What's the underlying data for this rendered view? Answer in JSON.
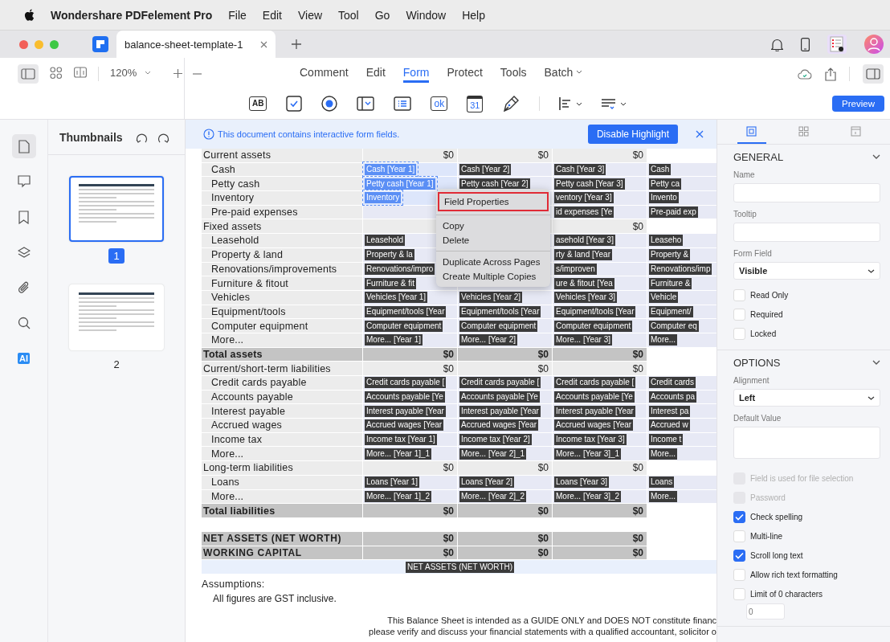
{
  "menubar": {
    "app": "Wondershare PDFelement Pro",
    "items": [
      "File",
      "Edit",
      "View",
      "Tool",
      "Go",
      "Window",
      "Help"
    ]
  },
  "tab": {
    "title": "balance-sheet-template-1"
  },
  "toolbar": {
    "zoom": "120%",
    "modes": [
      {
        "label": "Comment",
        "selected": false,
        "dropdown": false
      },
      {
        "label": "Edit",
        "selected": false,
        "dropdown": false
      },
      {
        "label": "Form",
        "selected": true,
        "dropdown": false
      },
      {
        "label": "Protect",
        "selected": false,
        "dropdown": false
      },
      {
        "label": "Tools",
        "selected": false,
        "dropdown": false
      },
      {
        "label": "Batch",
        "selected": false,
        "dropdown": true
      }
    ],
    "form_tools": [
      {
        "kind": "text-field",
        "glyph": "AB"
      },
      {
        "kind": "checkbox"
      },
      {
        "kind": "radio"
      },
      {
        "kind": "dropdown"
      },
      {
        "kind": "list"
      },
      {
        "kind": "button",
        "glyph": "ok"
      },
      {
        "kind": "date",
        "glyph": "31"
      },
      {
        "kind": "signature"
      }
    ],
    "preview": "Preview"
  },
  "sidebar": {
    "title": "Thumbnails",
    "rail": [
      {
        "kind": "page",
        "selected": true
      },
      {
        "kind": "comment",
        "selected": false
      },
      {
        "kind": "bookmark",
        "selected": false
      },
      {
        "kind": "layers",
        "selected": false
      },
      {
        "kind": "attachment",
        "selected": false
      },
      {
        "kind": "search",
        "selected": false
      },
      {
        "kind": "ai",
        "selected": false,
        "label": "AI"
      }
    ],
    "pages": [
      {
        "number": "1",
        "selected": true
      },
      {
        "number": "2",
        "selected": false
      }
    ]
  },
  "banner": {
    "message": "This document contains interactive form fields.",
    "button": "Disable Highlight"
  },
  "sheet": {
    "rows": [
      {
        "label": "Current assets",
        "kind": "section",
        "cells": [
          {
            "kind": "value",
            "text": "$0"
          },
          {
            "kind": "value",
            "text": "$0"
          },
          {
            "kind": "value",
            "text": "$0"
          },
          {
            "kind": "blank"
          }
        ]
      },
      {
        "label": "Cash",
        "kind": "item",
        "cells": [
          {
            "kind": "tag",
            "text": "Cash [Year 1]",
            "selected": true
          },
          {
            "kind": "tag",
            "text": "Cash [Year 2]",
            "selected": false
          },
          {
            "kind": "tag",
            "text": "Cash [Year 3]",
            "selected": false
          },
          {
            "kind": "tag",
            "text": "Cash",
            "selected": false
          }
        ]
      },
      {
        "label": "Petty cash",
        "kind": "item",
        "cells": [
          {
            "kind": "tag",
            "text": "Petty cash [Year 1]",
            "selected": true
          },
          {
            "kind": "tag",
            "text": "Petty cash [Year 2]",
            "selected": false
          },
          {
            "kind": "tag",
            "text": "Petty cash [Year 3]",
            "selected": false
          },
          {
            "kind": "tag",
            "text": "Petty ca",
            "selected": false
          }
        ]
      },
      {
        "label": "Inventory",
        "kind": "item",
        "cells": [
          {
            "kind": "tag",
            "text": "Inventory",
            "selected": true
          },
          {
            "kind": "blank"
          },
          {
            "kind": "tag",
            "text": "ventory [Year 3]",
            "selected": false
          },
          {
            "kind": "tag",
            "text": "Invento",
            "selected": false
          }
        ]
      },
      {
        "label": "Pre-paid expenses",
        "kind": "item",
        "cells": [
          {
            "kind": "blank"
          },
          {
            "kind": "blank"
          },
          {
            "kind": "tag",
            "text": "id expenses [Ye",
            "selected": false
          },
          {
            "kind": "tag",
            "text": "Pre-paid exp",
            "selected": false
          }
        ]
      },
      {
        "label": "Fixed assets",
        "kind": "section",
        "cells": [
          {
            "kind": "blank"
          },
          {
            "kind": "blank"
          },
          {
            "kind": "value",
            "text": "$0"
          },
          {
            "kind": "blank"
          }
        ]
      },
      {
        "label": "Leasehold",
        "kind": "item",
        "cells": [
          {
            "kind": "tag",
            "text": "Leasehold",
            "selected": false
          },
          {
            "kind": "blank"
          },
          {
            "kind": "tag",
            "text": "asehold [Year 3]",
            "selected": false
          },
          {
            "kind": "tag",
            "text": "Leaseho",
            "selected": false
          }
        ]
      },
      {
        "label": "Property & land",
        "kind": "item",
        "cells": [
          {
            "kind": "tag",
            "text": "Property & la",
            "selected": false
          },
          {
            "kind": "blank"
          },
          {
            "kind": "tag",
            "text": "rty & land [Year",
            "selected": false
          },
          {
            "kind": "tag",
            "text": "Property &",
            "selected": false
          }
        ]
      },
      {
        "label": "Renovations/improvements",
        "kind": "item",
        "cells": [
          {
            "kind": "tag",
            "text": "Renovations/impro",
            "selected": false
          },
          {
            "kind": "blank"
          },
          {
            "kind": "tag",
            "text": "s/improven",
            "selected": false
          },
          {
            "kind": "tag",
            "text": "Renovations/imp",
            "selected": false
          }
        ]
      },
      {
        "label": "Furniture & fitout",
        "kind": "item",
        "cells": [
          {
            "kind": "tag",
            "text": "Furniture & fit",
            "selected": false
          },
          {
            "kind": "blank"
          },
          {
            "kind": "tag",
            "text": "ure & fitout [Yea",
            "selected": false
          },
          {
            "kind": "tag",
            "text": "Furniture &",
            "selected": false
          }
        ]
      },
      {
        "label": "Vehicles",
        "kind": "item",
        "cells": [
          {
            "kind": "tag",
            "text": "Vehicles [Year 1]",
            "selected": false
          },
          {
            "kind": "tag",
            "text": "Vehicles [Year 2]",
            "selected": false
          },
          {
            "kind": "tag",
            "text": "Vehicles [Year 3]",
            "selected": false
          },
          {
            "kind": "tag",
            "text": "Vehicle",
            "selected": false
          }
        ]
      },
      {
        "label": "Equipment/tools",
        "kind": "item",
        "cells": [
          {
            "kind": "tag",
            "text": "Equipment/tools [Year",
            "selected": false
          },
          {
            "kind": "tag",
            "text": "Equipment/tools [Year",
            "selected": false
          },
          {
            "kind": "tag",
            "text": "Equipment/tools [Year",
            "selected": false
          },
          {
            "kind": "tag",
            "text": "Equipment/",
            "selected": false
          }
        ]
      },
      {
        "label": "Computer equipment",
        "kind": "item",
        "cells": [
          {
            "kind": "tag",
            "text": "Computer equipment",
            "selected": false
          },
          {
            "kind": "tag",
            "text": "Computer equipment",
            "selected": false
          },
          {
            "kind": "tag",
            "text": "Computer equipment",
            "selected": false
          },
          {
            "kind": "tag",
            "text": "Computer eq",
            "selected": false
          }
        ]
      },
      {
        "label": "More...",
        "kind": "item",
        "cells": [
          {
            "kind": "tag",
            "text": "More... [Year 1]",
            "selected": false
          },
          {
            "kind": "tag",
            "text": "More... [Year 2]",
            "selected": false
          },
          {
            "kind": "tag",
            "text": "More... [Year 3]",
            "selected": false
          },
          {
            "kind": "tag",
            "text": "More...",
            "selected": false
          }
        ]
      },
      {
        "label": "Total assets",
        "kind": "total",
        "cells": [
          {
            "kind": "value",
            "text": "$0"
          },
          {
            "kind": "value",
            "text": "$0"
          },
          {
            "kind": "value",
            "text": "$0"
          },
          {
            "kind": "blank"
          }
        ]
      },
      {
        "label": "Current/short-term liabilities",
        "kind": "section",
        "cells": [
          {
            "kind": "value",
            "text": "$0"
          },
          {
            "kind": "value",
            "text": "$0"
          },
          {
            "kind": "value",
            "text": "$0"
          },
          {
            "kind": "blank"
          }
        ]
      },
      {
        "label": "Credit cards payable",
        "kind": "item",
        "cells": [
          {
            "kind": "tag",
            "text": "Credit cards payable [",
            "selected": false
          },
          {
            "kind": "tag",
            "text": "Credit cards payable [",
            "selected": false
          },
          {
            "kind": "tag",
            "text": "Credit cards payable [",
            "selected": false
          },
          {
            "kind": "tag",
            "text": "Credit cards",
            "selected": false
          }
        ]
      },
      {
        "label": "Accounts payable",
        "kind": "item",
        "cells": [
          {
            "kind": "tag",
            "text": "Accounts payable [Ye",
            "selected": false
          },
          {
            "kind": "tag",
            "text": "Accounts payable [Ye",
            "selected": false
          },
          {
            "kind": "tag",
            "text": "Accounts payable [Ye",
            "selected": false
          },
          {
            "kind": "tag",
            "text": "Accounts pa",
            "selected": false
          }
        ]
      },
      {
        "label": "Interest payable",
        "kind": "item",
        "cells": [
          {
            "kind": "tag",
            "text": "Interest payable [Year",
            "selected": false
          },
          {
            "kind": "tag",
            "text": "Interest payable [Year",
            "selected": false
          },
          {
            "kind": "tag",
            "text": "Interest payable [Year",
            "selected": false
          },
          {
            "kind": "tag",
            "text": "Interest pa",
            "selected": false
          }
        ]
      },
      {
        "label": "Accrued wages",
        "kind": "item",
        "cells": [
          {
            "kind": "tag",
            "text": "Accrued wages [Year",
            "selected": false
          },
          {
            "kind": "tag",
            "text": "Accrued wages [Year",
            "selected": false
          },
          {
            "kind": "tag",
            "text": "Accrued wages [Year",
            "selected": false
          },
          {
            "kind": "tag",
            "text": "Accrued w",
            "selected": false
          }
        ]
      },
      {
        "label": "Income tax",
        "kind": "item",
        "cells": [
          {
            "kind": "tag",
            "text": "Income tax [Year 1]",
            "selected": false
          },
          {
            "kind": "tag",
            "text": "Income tax [Year 2]",
            "selected": false
          },
          {
            "kind": "tag",
            "text": "Income tax [Year 3]",
            "selected": false
          },
          {
            "kind": "tag",
            "text": "Income t",
            "selected": false
          }
        ]
      },
      {
        "label": "More...",
        "kind": "item",
        "cells": [
          {
            "kind": "tag",
            "text": "More... [Year 1]_1",
            "selected": false
          },
          {
            "kind": "tag",
            "text": "More... [Year 2]_1",
            "selected": false
          },
          {
            "kind": "tag",
            "text": "More... [Year 3]_1",
            "selected": false
          },
          {
            "kind": "tag",
            "text": "More...",
            "selected": false
          }
        ]
      },
      {
        "label": "Long-term liabilities",
        "kind": "section",
        "cells": [
          {
            "kind": "value",
            "text": "$0"
          },
          {
            "kind": "value",
            "text": "$0"
          },
          {
            "kind": "value",
            "text": "$0"
          },
          {
            "kind": "blank"
          }
        ]
      },
      {
        "label": "Loans",
        "kind": "item",
        "cells": [
          {
            "kind": "tag",
            "text": "Loans [Year 1]",
            "selected": false
          },
          {
            "kind": "tag",
            "text": "Loans [Year 2]",
            "selected": false
          },
          {
            "kind": "tag",
            "text": "Loans [Year 3]",
            "selected": false
          },
          {
            "kind": "tag",
            "text": "Loans",
            "selected": false
          }
        ]
      },
      {
        "label": "More...",
        "kind": "item",
        "cells": [
          {
            "kind": "tag",
            "text": "More... [Year 1]_2",
            "selected": false
          },
          {
            "kind": "tag",
            "text": "More... [Year 2]_2",
            "selected": false
          },
          {
            "kind": "tag",
            "text": "More... [Year 3]_2",
            "selected": false
          },
          {
            "kind": "tag",
            "text": "More...",
            "selected": false
          }
        ]
      },
      {
        "label": "Total liabilities",
        "kind": "total",
        "cells": [
          {
            "kind": "value",
            "text": "$0"
          },
          {
            "kind": "value",
            "text": "$0"
          },
          {
            "kind": "value",
            "text": "$0"
          },
          {
            "kind": "blank"
          }
        ]
      },
      {
        "label": "NET ASSETS (NET WORTH)",
        "kind": "grand",
        "cells": [
          {
            "kind": "value",
            "text": "$0"
          },
          {
            "kind": "value",
            "text": "$0"
          },
          {
            "kind": "value",
            "text": "$0"
          },
          {
            "kind": "blank"
          }
        ]
      },
      {
        "label": "WORKING CAPITAL",
        "kind": "grand",
        "cells": [
          {
            "kind": "value",
            "text": "$0"
          },
          {
            "kind": "value",
            "text": "$0"
          },
          {
            "kind": "value",
            "text": "$0"
          },
          {
            "kind": "blank"
          }
        ]
      }
    ],
    "net_tag": "NET ASSETS (NET WORTH)",
    "assumptions_title": "Assumptions:",
    "assumption": "All figures are GST inclusive.",
    "disclaimer": [
      "This Balance Sheet is intended as a GUIDE ONLY and DOES NOT constitute financ",
      "please verify and discuss your financial statements with a qualified accountant, solicitor o"
    ]
  },
  "context_menu": {
    "groups": [
      [
        {
          "label": "Field Properties",
          "highlighted": true
        }
      ],
      [
        {
          "label": "Copy",
          "highlighted": false
        },
        {
          "label": "Delete",
          "highlighted": false
        }
      ],
      [
        {
          "label": "Duplicate Across Pages",
          "highlighted": false
        },
        {
          "label": "Create Multiple Copies",
          "highlighted": false
        }
      ]
    ]
  },
  "properties": {
    "tabs": [
      {
        "kind": "field",
        "selected": true
      },
      {
        "kind": "grid",
        "selected": false
      },
      {
        "kind": "layout",
        "selected": false
      }
    ],
    "general": {
      "title": "GENERAL",
      "name_label": "Name",
      "tooltip_label": "Tooltip",
      "form_field_label": "Form Field",
      "form_field": "Visible",
      "checks": [
        {
          "label": "Read Only",
          "checked": false,
          "disabled": false
        },
        {
          "label": "Required",
          "checked": false,
          "disabled": false
        },
        {
          "label": "Locked",
          "checked": false,
          "disabled": false
        }
      ]
    },
    "options": {
      "title": "OPTIONS",
      "alignment_label": "Alignment",
      "alignment": "Left",
      "default_label": "Default Value",
      "checks": [
        {
          "label": "Field is used for file selection",
          "checked": false,
          "disabled": true
        },
        {
          "label": "Password",
          "checked": false,
          "disabled": true
        },
        {
          "label": "Check spelling",
          "checked": true,
          "disabled": false
        },
        {
          "label": "Multi-line",
          "checked": false,
          "disabled": false
        },
        {
          "label": "Scroll long text",
          "checked": true,
          "disabled": false
        },
        {
          "label": "Allow rich text formatting",
          "checked": false,
          "disabled": false
        },
        {
          "label": "Limit of 0 characters",
          "checked": false,
          "disabled": false
        }
      ],
      "limit_placeholder": "0"
    }
  }
}
